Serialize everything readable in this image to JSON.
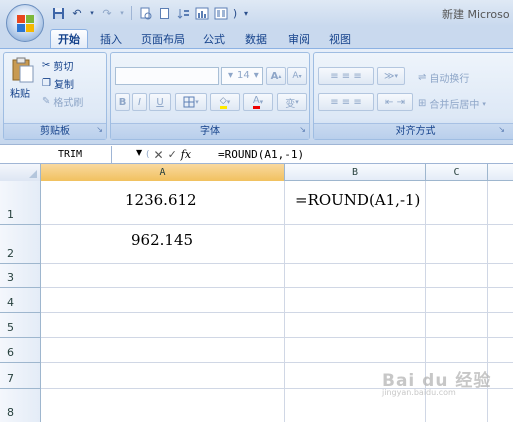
{
  "window": {
    "title": "新建 Microso"
  },
  "tabs": [
    {
      "label": "开始",
      "active": true
    },
    {
      "label": "插入"
    },
    {
      "label": "页面布局"
    },
    {
      "label": "公式"
    },
    {
      "label": "数据"
    },
    {
      "label": "审阅"
    },
    {
      "label": "视图"
    }
  ],
  "ribbon": {
    "clipboard": {
      "label": "剪贴板",
      "paste": "粘贴",
      "cut": "剪切",
      "copy": "复制",
      "format_painter": "格式刷"
    },
    "font": {
      "label": "字体",
      "size": "14",
      "bold": "B",
      "italic": "I",
      "underline": "U",
      "grow": "A",
      "shrink": "A",
      "font_color": "A",
      "phonetic": "变"
    },
    "alignment": {
      "label": "对齐方式",
      "wrap_text": "自动换行",
      "merge_center": "合并后居中"
    }
  },
  "formula_bar": {
    "name_box": "TRIM",
    "formula": "=ROUND(A1,-1)"
  },
  "grid": {
    "columns": [
      "A",
      "B",
      "C"
    ],
    "rows": [
      "1",
      "2",
      "3",
      "4",
      "5",
      "6",
      "7",
      "8"
    ],
    "cells": {
      "A1": "1236.612",
      "B1": "=ROUND(A1,-1)",
      "A2": "962.145"
    }
  },
  "watermark": {
    "main": "Bai du 经验",
    "sub": "jingyan.baidu.com"
  },
  "colors": {
    "ribbon_bg": "#dbe6f4",
    "tab_text": "#15428b",
    "header_sel": "#f1c15f",
    "grid_line": "#d0d7e5"
  }
}
